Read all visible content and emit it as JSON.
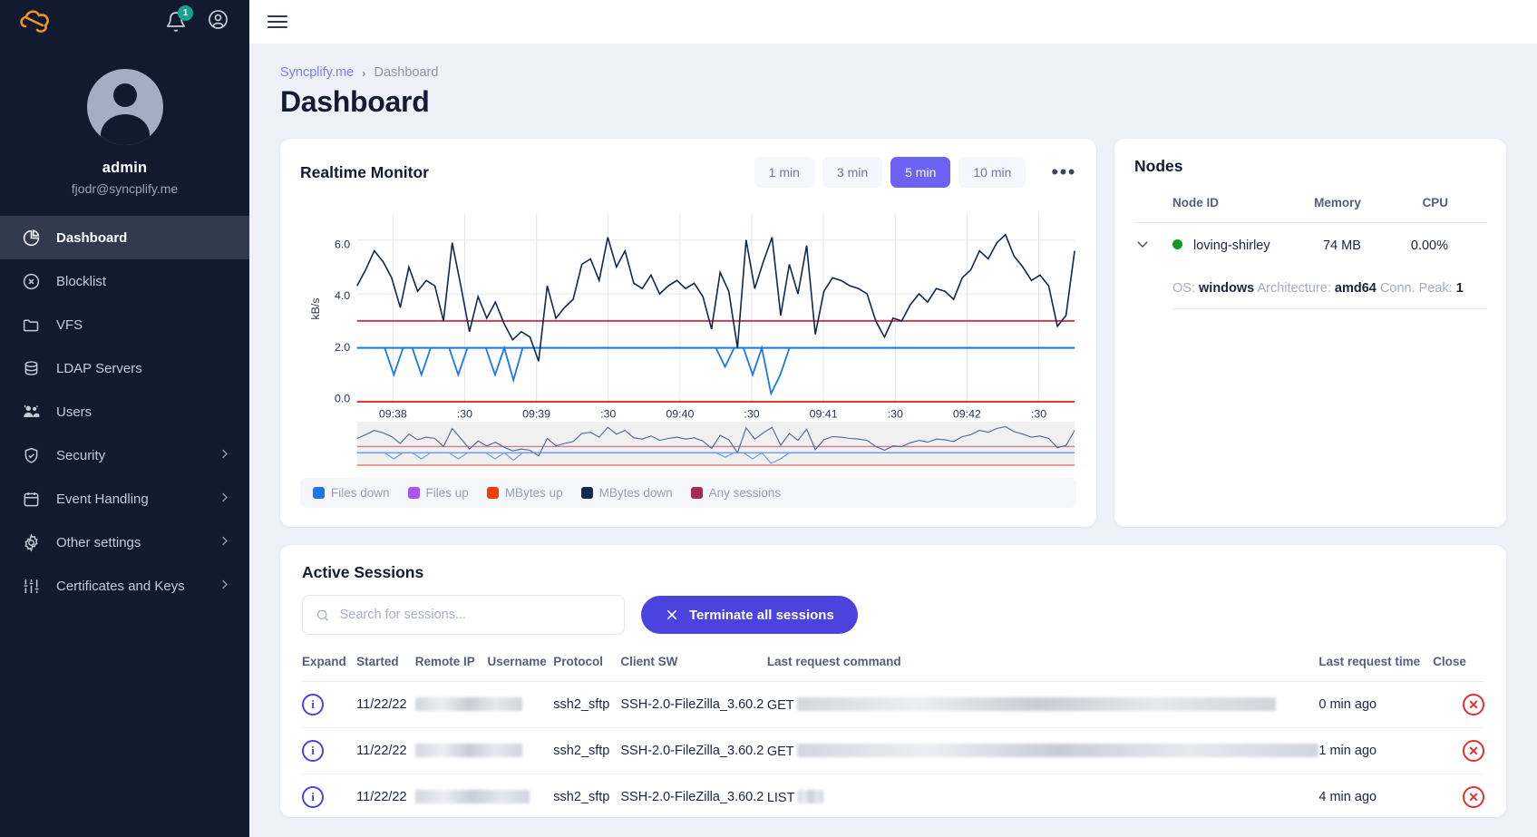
{
  "sidebar": {
    "logo_icon": "syncplify-cloud-logo",
    "notification_badge": "1",
    "user": {
      "name": "admin",
      "email": "fjodr@syncplify.me"
    },
    "items": [
      {
        "label": "Dashboard",
        "icon": "pie-chart-icon",
        "active": true,
        "chevron": false
      },
      {
        "label": "Blocklist",
        "icon": "block-circle-icon",
        "active": false,
        "chevron": false
      },
      {
        "label": "VFS",
        "icon": "folder-icon",
        "active": false,
        "chevron": false
      },
      {
        "label": "LDAP Servers",
        "icon": "database-icon",
        "active": false,
        "chevron": false
      },
      {
        "label": "Users",
        "icon": "users-icon",
        "active": false,
        "chevron": false
      },
      {
        "label": "Security",
        "icon": "shield-check-icon",
        "active": false,
        "chevron": true
      },
      {
        "label": "Event Handling",
        "icon": "calendar-icon",
        "active": false,
        "chevron": true
      },
      {
        "label": "Other settings",
        "icon": "gear-icon",
        "active": false,
        "chevron": true
      },
      {
        "label": "Certificates and Keys",
        "icon": "sliders-icon",
        "active": false,
        "chevron": true
      }
    ]
  },
  "header": {
    "menu_icon": "hamburger-menu-icon",
    "breadcrumb_root": "Syncplify.me",
    "breadcrumb_sep": "›",
    "breadcrumb_current": "Dashboard",
    "page_title": "Dashboard"
  },
  "monitor": {
    "title": "Realtime Monitor",
    "ranges": [
      "1 min",
      "3 min",
      "5 min",
      "10 min"
    ],
    "selected_range": "5 min",
    "more_icon": "ellipsis-icon"
  },
  "chart_data": {
    "type": "line",
    "title": "Realtime Monitor",
    "xlabel": "",
    "ylabel": "kB/s",
    "ylim": [
      0,
      7
    ],
    "yticks": [
      "0.0",
      "2.0",
      "4.0",
      "6.0"
    ],
    "xticks": [
      "09:38",
      ":30",
      "09:39",
      ":30",
      "09:40",
      ":30",
      "09:41",
      ":30",
      "09:42",
      ":30"
    ],
    "grid": true,
    "legend_position": "bottom",
    "series": [
      {
        "name": "Files down",
        "color": "#1877f2",
        "flat_value": 2.0,
        "values": [
          2,
          2,
          2,
          2,
          1,
          2,
          2,
          1,
          2,
          2,
          2,
          1,
          2,
          2,
          2,
          1,
          2,
          0.8,
          2,
          2,
          2,
          2,
          2,
          2,
          2,
          2,
          2,
          2,
          2,
          2,
          2,
          2,
          2,
          2,
          2,
          2,
          2,
          2,
          2,
          2,
          1.3,
          2,
          2,
          1,
          2,
          0.3,
          1,
          2,
          2,
          2,
          2,
          2,
          2,
          2,
          2,
          2,
          2,
          2,
          2,
          2,
          2,
          2,
          2,
          2,
          2,
          2,
          2,
          2,
          2,
          2,
          2,
          2,
          2,
          2,
          2,
          2,
          2,
          2,
          2
        ]
      },
      {
        "name": "Files up",
        "color": "#a855f7",
        "flat_value": 0.0,
        "values": []
      },
      {
        "name": "MBytes up",
        "color": "#f03e02",
        "flat_value": 0.0,
        "values": [
          0,
          0,
          0,
          0,
          0,
          0,
          0,
          0,
          0,
          0,
          0,
          0,
          0,
          0,
          0,
          0,
          0,
          0,
          0,
          0,
          0,
          0,
          0,
          0,
          0,
          0,
          0,
          0,
          0,
          0,
          0,
          0,
          0,
          0,
          0,
          0,
          0,
          0,
          0,
          0
        ]
      },
      {
        "name": "MBytes down",
        "color": "#10284f",
        "values": [
          4.3,
          4.9,
          5.6,
          5.2,
          4.6,
          3.5,
          5.0,
          4.1,
          4.5,
          4.3,
          3.0,
          5.9,
          4.3,
          2.6,
          3.9,
          3.1,
          3.7,
          2.9,
          2.3,
          2.6,
          2.4,
          1.5,
          4.3,
          3.1,
          3.5,
          3.8,
          5.1,
          5.3,
          4.5,
          6.1,
          5.0,
          5.6,
          4.4,
          4.2,
          4.7,
          4.0,
          4.3,
          4.5,
          4.2,
          4.4,
          3.9,
          2.7,
          4.8,
          4.1,
          2.0,
          6.0,
          4.2,
          5.2,
          6.1,
          3.2,
          5.1,
          4.0,
          5.8,
          2.5,
          4.1,
          4.6,
          4.5,
          4.3,
          4.2,
          4.0,
          3.0,
          2.4,
          3.1,
          3.0,
          3.6,
          4.0,
          3.7,
          4.2,
          4.1,
          3.8,
          4.6,
          4.9,
          5.6,
          5.3,
          5.9,
          6.2,
          5.4,
          5.0,
          4.5,
          4.7,
          4.3,
          2.8,
          3.2,
          5.6
        ]
      },
      {
        "name": "Any sessions",
        "color": "#a62b50",
        "flat_value": 3.0,
        "values": []
      }
    ],
    "reference_lines": [
      {
        "value": 3.0,
        "color": "#c2405f"
      },
      {
        "value": 2.0,
        "color": "#1877f2"
      },
      {
        "value": 0.0,
        "color": "#e03a2a"
      }
    ]
  },
  "nodes": {
    "title": "Nodes",
    "columns": [
      "Node ID",
      "Memory",
      "CPU"
    ],
    "expand_icon": "chevron-down-icon",
    "status_icon": "status-dot-online",
    "rows": [
      {
        "node_id": "loving-shirley",
        "memory": "74 MB",
        "cpu": "0.00%",
        "details": [
          {
            "key": "OS:",
            "value": "windows"
          },
          {
            "key": "Architecture:",
            "value": "amd64"
          },
          {
            "key": "Conn. Peak:",
            "value": "1"
          }
        ]
      }
    ]
  },
  "sessions": {
    "title": "Active Sessions",
    "search_placeholder": "Search for sessions...",
    "search_value": "",
    "search_icon": "search-icon",
    "terminate_label": "Terminate all sessions",
    "terminate_icon": "close-x-icon",
    "columns": [
      "Expand",
      "Started",
      "Remote IP",
      "Username",
      "Protocol",
      "Client SW",
      "Last request command",
      "Last request time",
      "Close"
    ],
    "rows": [
      {
        "expand_icon": "info-icon",
        "started": "11/22/22",
        "remote_ip": "",
        "username": "",
        "protocol": "ssh2_sftp",
        "client_sw": "SSH-2.0-FileZilla_3.60.2",
        "command": "GET",
        "last_request_time": "0 min ago",
        "close_icon": "close-circle-icon",
        "redact_ip_w": 118,
        "redact_cmd_w": 528
      },
      {
        "expand_icon": "info-icon",
        "started": "11/22/22",
        "remote_ip": "",
        "username": "",
        "protocol": "ssh2_sftp",
        "client_sw": "SSH-2.0-FileZilla_3.60.2",
        "command": "GET",
        "last_request_time": "1 min ago",
        "close_icon": "close-circle-icon",
        "redact_ip_w": 118,
        "redact_cmd_w": 575
      },
      {
        "expand_icon": "info-icon",
        "started": "11/22/22",
        "remote_ip": "",
        "username": "",
        "protocol": "ssh2_sftp",
        "client_sw": "SSH-2.0-FileZilla_3.60.2",
        "command": "LIST",
        "last_request_time": "4 min ago",
        "close_icon": "close-circle-icon",
        "redact_ip_w": 126,
        "redact_cmd_w": 28
      }
    ]
  },
  "colors": {
    "accent": "#4b42e0",
    "sidebar_bg": "#111a2e",
    "page_bg": "#eef1f8",
    "brand_orange": "#f59120",
    "online_green": "#0f9d20",
    "danger_red": "#e03131"
  }
}
